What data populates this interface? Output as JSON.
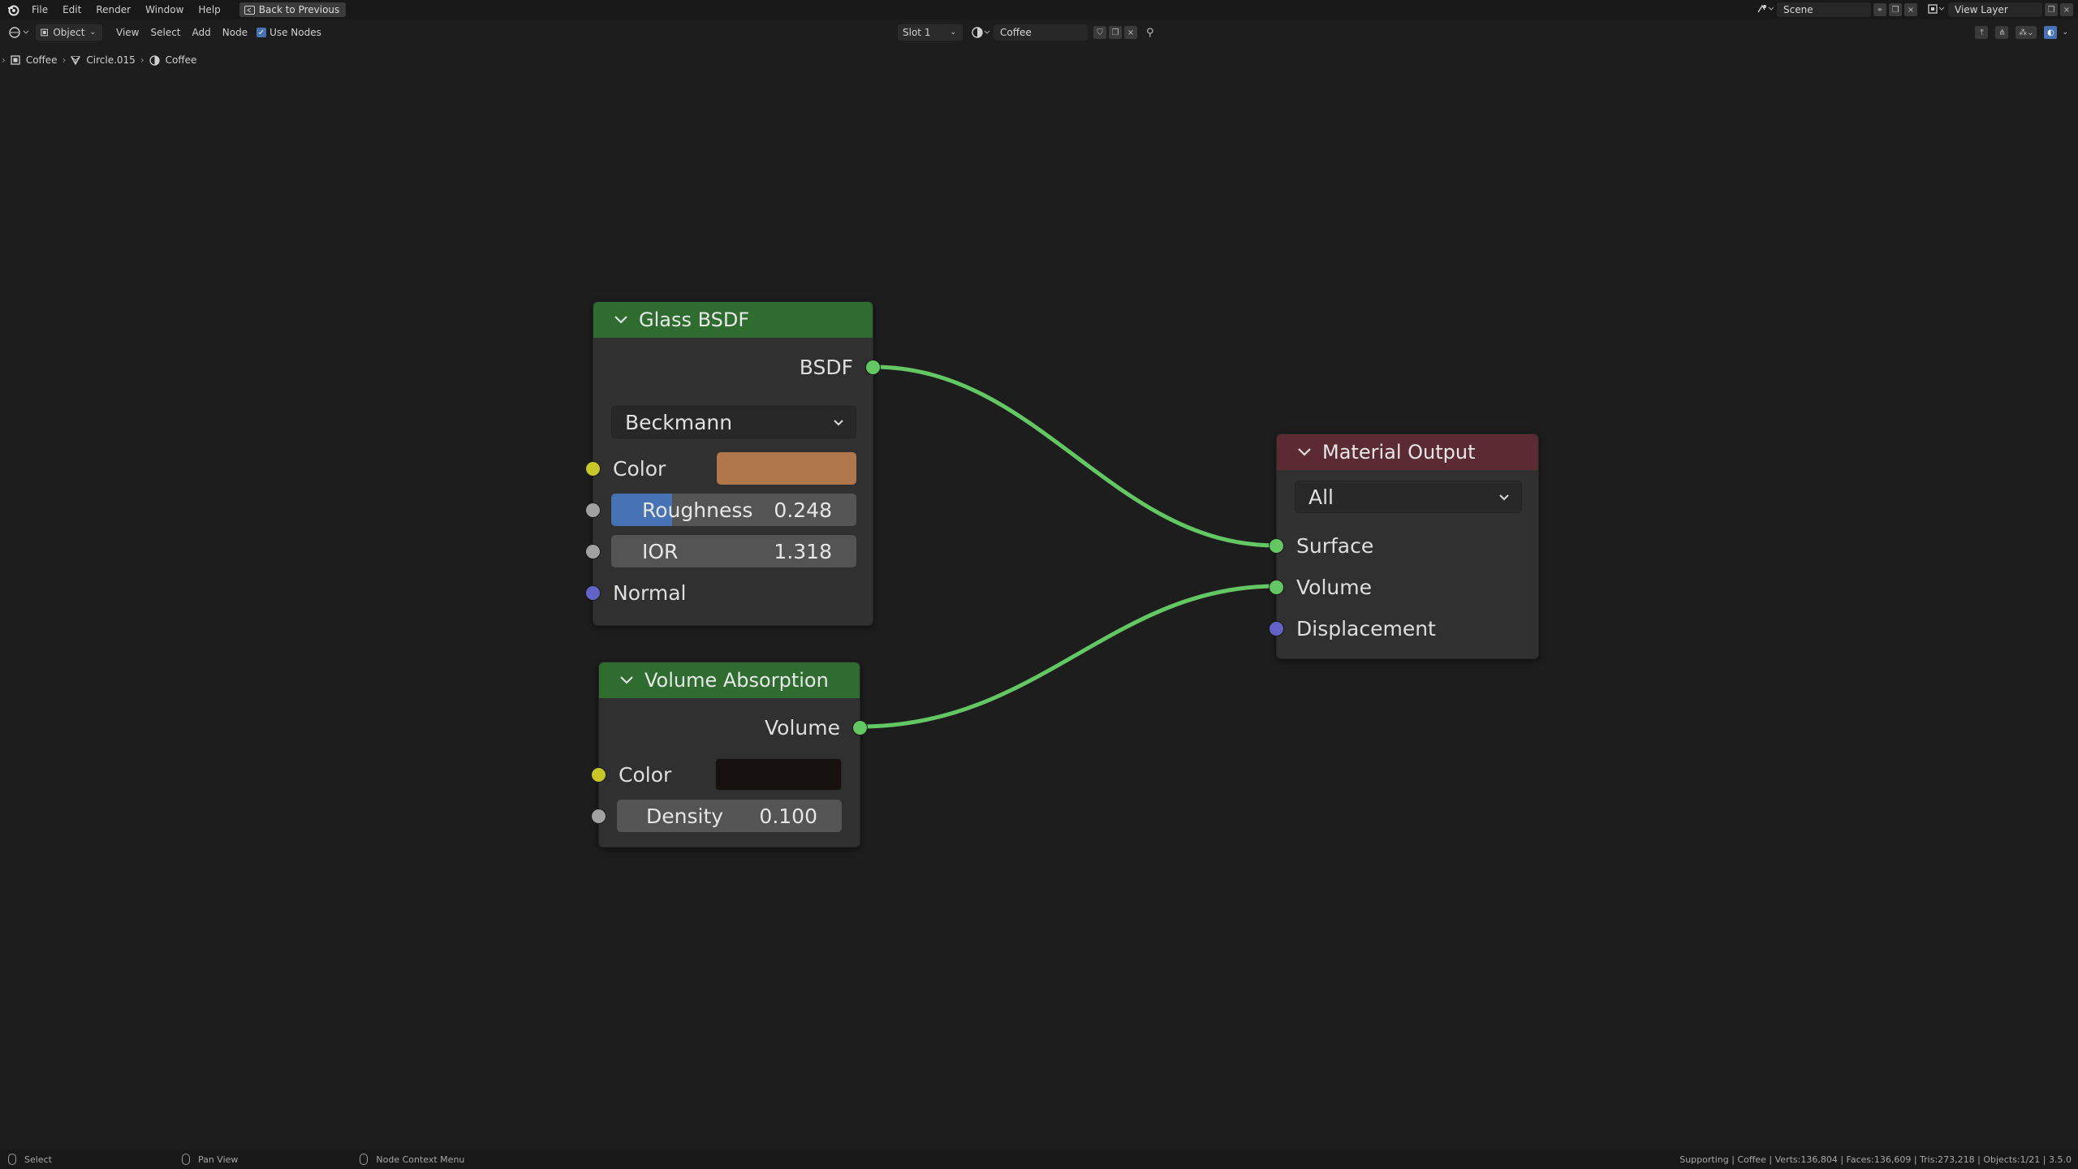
{
  "menu": {
    "items": [
      "File",
      "Edit",
      "Render",
      "Window",
      "Help"
    ],
    "back_button": "Back to Previous"
  },
  "scene": {
    "label": "Scene",
    "view_layer": "View Layer"
  },
  "header": {
    "mode": "Object",
    "items": [
      "View",
      "Select",
      "Add",
      "Node"
    ],
    "use_nodes_label": "Use Nodes",
    "use_nodes_checked": true,
    "slot": "Slot 1",
    "material": "Coffee"
  },
  "breadcrumb": [
    "Coffee",
    "Circle.015",
    "Coffee"
  ],
  "nodes": {
    "glass": {
      "title": "Glass BSDF",
      "output": "BSDF",
      "distribution": "Beckmann",
      "color_label": "Color",
      "color_value": "#b0774a",
      "roughness_label": "Roughness",
      "roughness_value": "0.248",
      "roughness_fraction": 0.248,
      "ior_label": "IOR",
      "ior_value": "1.318",
      "normal_label": "Normal"
    },
    "volume": {
      "title": "Volume Absorption",
      "output": "Volume",
      "color_label": "Color",
      "color_value": "#16110e",
      "density_label": "Density",
      "density_value": "0.100"
    },
    "output": {
      "title": "Material Output",
      "target": "All",
      "surface": "Surface",
      "volume": "Volume",
      "displacement": "Displacement"
    }
  },
  "colors": {
    "node_header_green": "#2e6c30",
    "node_header_red": "#5c2a33",
    "wire": "#63c763",
    "accent": "#4772b3"
  },
  "status": {
    "select": "Select",
    "pan": "Pan View",
    "context": "Node Context Menu",
    "stats": "Supporting | Coffee | Verts:136,804 | Faces:136,609 | Tris:273,218 | Objects:1/21 | 3.5.0"
  }
}
